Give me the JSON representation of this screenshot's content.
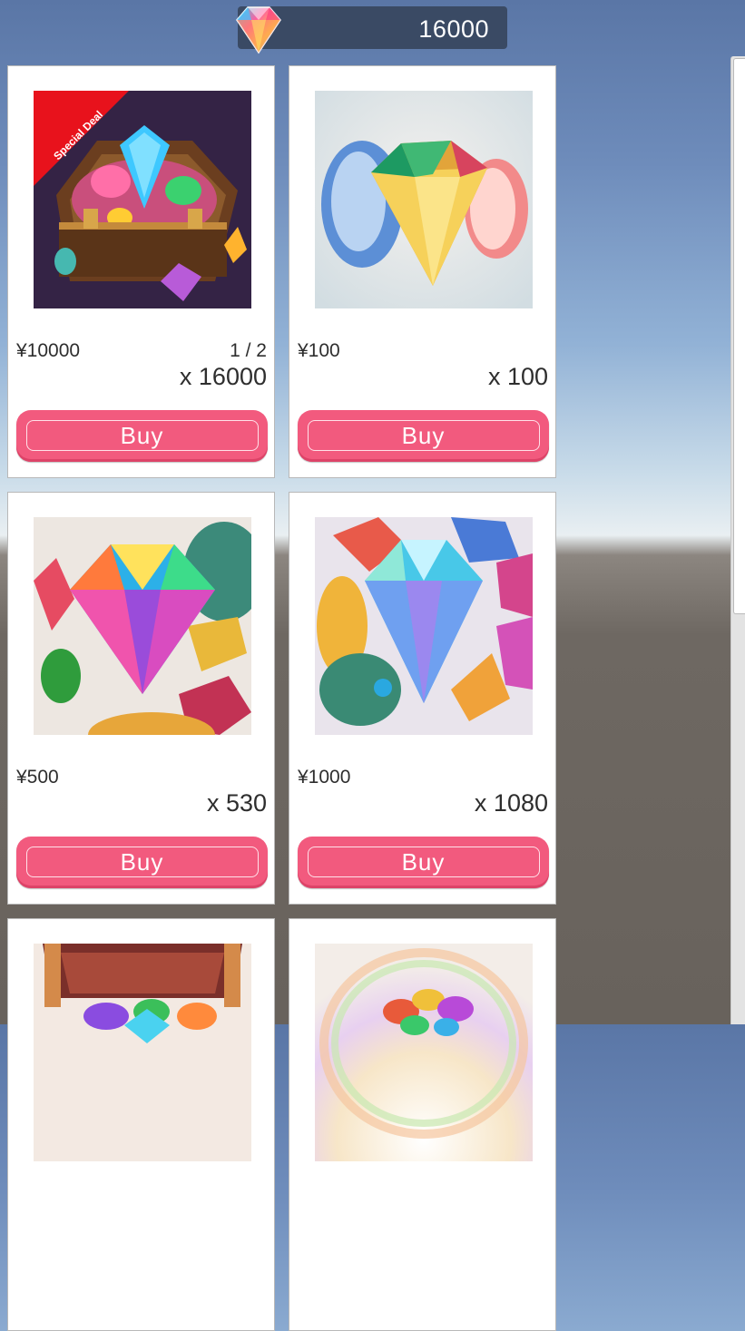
{
  "currency": {
    "amount": "16000",
    "icon": "rainbow-gem-icon"
  },
  "colors": {
    "button": "#f25a7e",
    "ribbon": "#e8121c",
    "currency_bar": "#3a4a64"
  },
  "cards": [
    {
      "price": "¥10000",
      "stock": "1 / 2",
      "quantity": "x 16000",
      "button": "Buy",
      "badge": "Special Deal",
      "art": "treasure-chest-with-gems"
    },
    {
      "price": "¥100",
      "stock": "",
      "quantity": "x 100",
      "button": "Buy",
      "art": "gem-pile-small"
    },
    {
      "price": "¥500",
      "stock": "",
      "quantity": "x 530",
      "button": "Buy",
      "art": "rainbow-diamond"
    },
    {
      "price": "¥1000",
      "stock": "",
      "quantity": "x 1080",
      "button": "Buy",
      "art": "crystal-diamond"
    },
    {
      "price": "",
      "stock": "",
      "quantity": "",
      "button": "",
      "art": "open-treasure-chest"
    },
    {
      "price": "",
      "stock": "",
      "quantity": "",
      "button": "",
      "art": "rainbow-gem-heap"
    }
  ]
}
